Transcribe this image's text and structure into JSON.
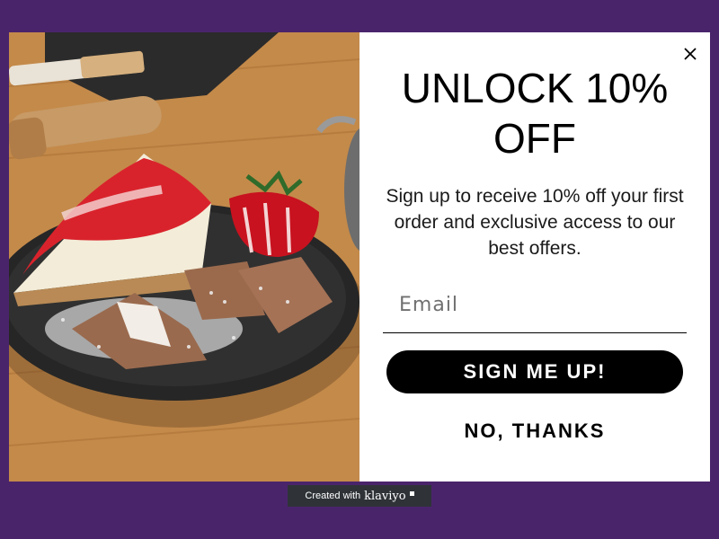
{
  "popup": {
    "close_icon": "close-icon",
    "headline": "UNLOCK 10% OFF",
    "subtext": "Sign up to receive 10% off your first order and exclusive access to our best offers.",
    "email": {
      "placeholder": "Email",
      "value": ""
    },
    "signup_label": "SIGN ME UP!",
    "decline_label": "NO, THANKS"
  },
  "badge": {
    "prefix": "Created with",
    "brand": "klaviyo"
  },
  "colors": {
    "page_background": "#4a246b",
    "modal_background": "#ffffff",
    "button_background": "#000000",
    "badge_background": "#2f3338"
  }
}
